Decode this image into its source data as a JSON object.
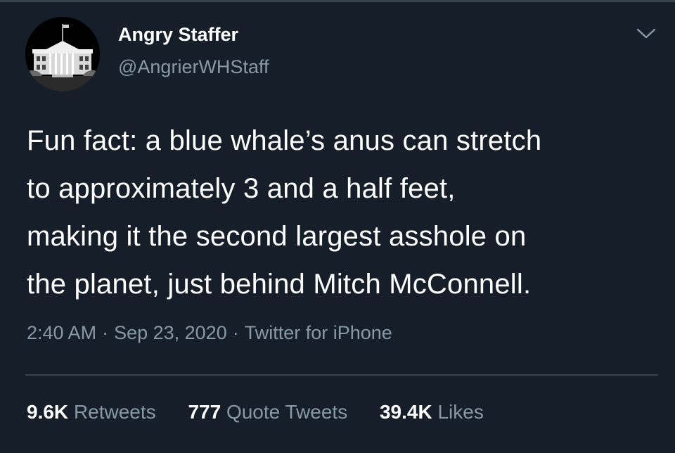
{
  "tweet": {
    "author": {
      "display_name": "Angry Staffer",
      "handle": "@AngrierWHStaff",
      "avatar_icon": "white-house-icon"
    },
    "menu_icon": "chevron-down-icon",
    "text_lines": [
      "Fun fact: a blue whale’s anus can stretch",
      "to approximately 3 and a half feet,",
      "making it the second largest asshole on",
      "the planet, just behind Mitch McConnell."
    ],
    "meta": {
      "time": "2:40 AM",
      "date": "Sep 23, 2020",
      "source": "Twitter for iPhone",
      "separator": "·"
    },
    "stats": {
      "retweets": {
        "count": "9.6K",
        "label": "Retweets"
      },
      "quote_tweets": {
        "count": "777",
        "label": "Quote Tweets"
      },
      "likes": {
        "count": "39.4K",
        "label": "Likes"
      }
    }
  },
  "colors": {
    "background": "#151e29",
    "primary_text": "#ffffff",
    "secondary_text": "#8899a6",
    "divider": "#38444d"
  }
}
